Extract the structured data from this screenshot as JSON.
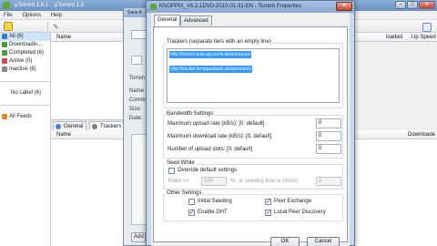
{
  "main_window": {
    "title": "μTorrent 1.8.1",
    "title_right": "μTorrent 1.8",
    "menu": [
      "File",
      "Options",
      "Help"
    ],
    "column_headers": [
      "Name",
      "loaded",
      "Up Speed"
    ],
    "sidebar": [
      {
        "label": "All (6)",
        "color": "#3c78c8",
        "selected": true
      },
      {
        "label": "Downloadin...",
        "color": "#4a9e3a",
        "selected": false
      },
      {
        "label": "Completed (6)",
        "color": "#4a9e3a",
        "selected": false
      },
      {
        "label": "Active (0)",
        "color": "#c85050",
        "selected": false
      },
      {
        "label": "Inactive (6)",
        "color": "#888888",
        "selected": false
      }
    ],
    "no_label": "No Label (6)",
    "rss": "All Feeds",
    "detail_tabs": [
      {
        "label": "General",
        "color": "#4a7fc0"
      },
      {
        "label": "Trackers",
        "color": "#7a7a7a"
      }
    ],
    "detail_header": "Name",
    "detail_right_header": "Downloade",
    "bottom_button": "Add"
  },
  "mid_dialog": {
    "title": "Save A",
    "labels": [
      "Torren",
      "Name",
      "Comm",
      "Size:",
      "Date:"
    ]
  },
  "dialog": {
    "title": "KNOPPIX_V6.2.1DVD-2010-01-31-EN - Torrent Properties",
    "close_label": "✕",
    "tabs": [
      "General",
      "Advanced"
    ],
    "trackers_label": "Trackers (separate tiers with an empty line)",
    "trackers": [
      "http://torrent.unix-ag.uni-kl.de/announce",
      "http://tracker.knoppuebeck.de/announce"
    ],
    "bandwidth_label": "Bandwidth Settings",
    "max_upload_label": "Maximum upload rate (kB/s): [0: default]",
    "max_upload_value": "0",
    "max_download_label": "Maximum download rate (kB/s): [0: default]",
    "max_download_value": "0",
    "upload_slots_label": "Number of upload slots: [0: default]",
    "upload_slots_value": "0",
    "seed_while_label": "Seed While",
    "override_label": "Override default settings",
    "ratio_label": "Ratio <=",
    "ratio_value": "100",
    "ratio_unit_label": "%, or seeding time is (mins)",
    "seeding_time_value": "0",
    "other_label": "Other Settings",
    "initial_seeding_label": "Initial Seeding",
    "initial_seeding_checked": false,
    "peer_exchange_label": "Peer Exchange",
    "peer_exchange_checked": true,
    "enable_dht_label": "Enable DHT",
    "enable_dht_checked": true,
    "local_peer_label": "Local Peer Discovery",
    "local_peer_checked": true,
    "ok_label": "OK",
    "cancel_label": "Cancel"
  }
}
